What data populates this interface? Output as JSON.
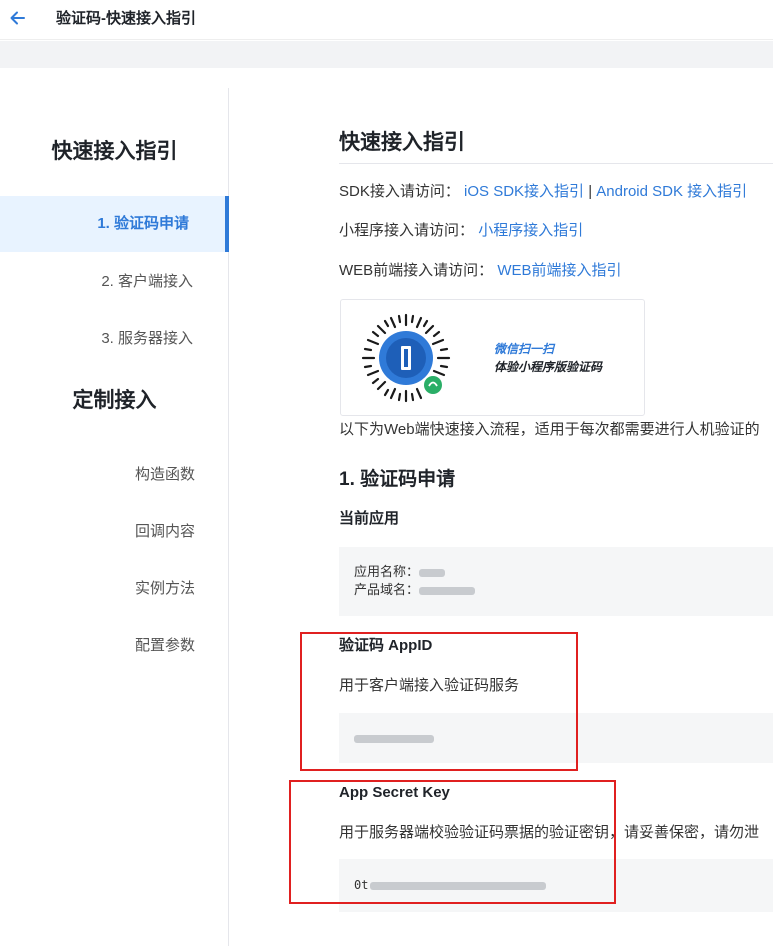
{
  "header": {
    "title": "验证码-快速接入指引",
    "back_icon": "arrow-left-icon"
  },
  "sidebar": {
    "section1_heading": "快速接入指引",
    "items": [
      {
        "label": "1. 验证码申请",
        "active": true
      },
      {
        "label": "2. 客户端接入",
        "active": false
      },
      {
        "label": "3. 服务器接入",
        "active": false
      }
    ],
    "section2_heading": "定制接入",
    "sub_items": [
      "构造函数",
      "回调内容",
      "实例方法",
      "配置参数"
    ]
  },
  "main": {
    "title": "快速接入指引",
    "sdk_prefix": "SDK接入请访问：",
    "sdk_ios_link": "iOS SDK接入指引",
    "sdk_separator": "|",
    "sdk_android_link": "Android SDK 接入指引",
    "miniprogram_prefix": "小程序接入请访问：",
    "miniprogram_link": "小程序接入指引",
    "web_prefix": "WEB前端接入请访问：",
    "web_link": "WEB前端接入指引",
    "qr_text_line1": "微信扫一扫",
    "qr_text_line2": "体验小程序版验证码",
    "intro": "以下为Web端快速接入流程，适用于每次都需要进行人机验证的",
    "section1_title": "1. 验证码申请",
    "current_app_label": "当前应用",
    "app_name_label": "应用名称：",
    "domain_label": "产品域名：",
    "appid_title": "验证码 AppID",
    "appid_desc": "用于客户端接入验证码服务",
    "secret_title": "App Secret Key",
    "secret_desc": "用于服务器端校验验证码票据的验证密钥，请妥善保密，请勿泄",
    "secret_prefix": "0t"
  },
  "colors": {
    "accent": "#2f7ad8",
    "annotation_red": "#e02020",
    "code_bg": "#f5f6f7"
  }
}
